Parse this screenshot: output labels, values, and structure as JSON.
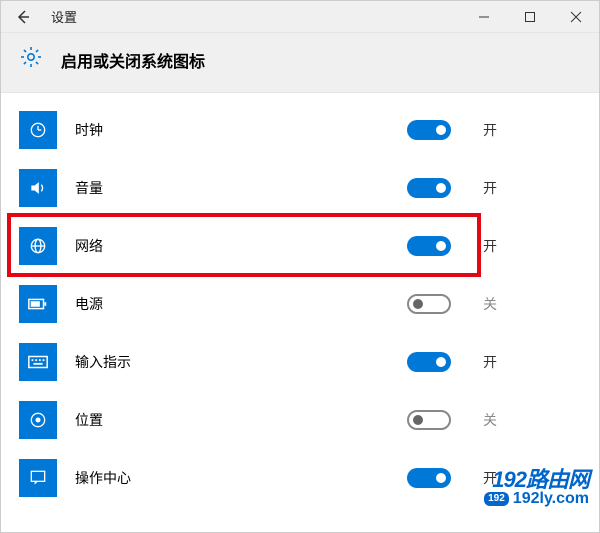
{
  "window": {
    "title": "设置"
  },
  "header": {
    "title": "启用或关闭系统图标"
  },
  "state_on": "开",
  "state_off": "关",
  "items": [
    {
      "label": "时钟",
      "on": true,
      "icon": "clock-icon"
    },
    {
      "label": "音量",
      "on": true,
      "icon": "volume-icon"
    },
    {
      "label": "网络",
      "on": true,
      "icon": "network-icon",
      "highlighted": true
    },
    {
      "label": "电源",
      "on": false,
      "icon": "power-icon"
    },
    {
      "label": "输入指示",
      "on": true,
      "icon": "input-indicator-icon"
    },
    {
      "label": "位置",
      "on": false,
      "icon": "location-icon"
    },
    {
      "label": "操作中心",
      "on": true,
      "icon": "action-center-icon"
    }
  ],
  "watermark": {
    "line1": "192路由网",
    "badge": "192",
    "line2": "192ly.com"
  }
}
